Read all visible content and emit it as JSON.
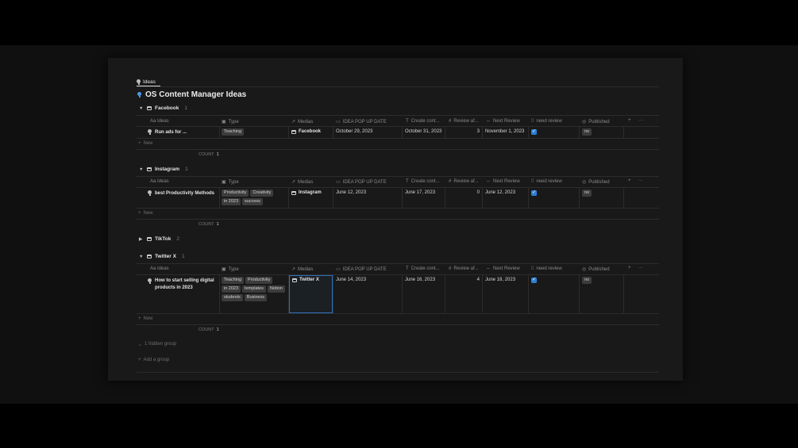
{
  "tab": {
    "label": "Ideas"
  },
  "page": {
    "title": "OS Content Manager Ideas"
  },
  "columns": [
    {
      "label": "Aa Ideas",
      "icon": ""
    },
    {
      "label": "Type",
      "icon": "tag-icon"
    },
    {
      "label": "Medias",
      "icon": "relation-arrow-icon"
    },
    {
      "label": "IDEA POP UP DATE",
      "icon": "calendar-icon"
    },
    {
      "label": "Create cont...",
      "icon": "formula-icon"
    },
    {
      "label": "Review af...",
      "icon": "hash-icon"
    },
    {
      "label": "Next Review",
      "icon": "rollup-icon"
    },
    {
      "label": "need review",
      "icon": "checkbox-icon"
    },
    {
      "label": "Published",
      "icon": "status-icon"
    }
  ],
  "groups": [
    {
      "name": "Facebook",
      "count": "1",
      "rows": [
        {
          "idea": "Run ads for ...",
          "types": [
            "Teaching"
          ],
          "media": "Facebook",
          "idea_date": "October 29, 2023",
          "create": "October 31, 2023",
          "review_after": "3",
          "next_review": "November 1, 2023",
          "need_review": true,
          "published": "no"
        }
      ],
      "new_label": "New",
      "count_label": "COUNT",
      "count_value": "1"
    },
    {
      "name": "Instagram",
      "count": "1",
      "rows": [
        {
          "idea": "best Productivity Methods",
          "types": [
            "Productivity",
            "Creativity",
            "in 2023",
            "success"
          ],
          "media": "Instagram",
          "idea_date": "June 12, 2023",
          "create": "June 17, 2023",
          "review_after": "0",
          "next_review": "June 12, 2023",
          "need_review": true,
          "published": "no"
        }
      ],
      "new_label": "New",
      "count_label": "COUNT",
      "count_value": "1"
    },
    {
      "name": "TikTok",
      "count": "2",
      "collapsed": true
    },
    {
      "name": "Twitter X",
      "count": "1",
      "rows": [
        {
          "idea": "How to start selling digital products in 2023",
          "types": [
            "Teaching",
            "Productivity",
            "in 2023",
            "templates",
            "Notion",
            "students",
            "Business"
          ],
          "media": "Twitter X",
          "idea_date": "June 14, 2023",
          "create": "June 16, 2023",
          "review_after": "4",
          "next_review": "June 18, 2023",
          "need_review": true,
          "published": "no"
        }
      ],
      "new_label": "New",
      "count_label": "COUNT",
      "count_value": "1"
    }
  ],
  "footer": {
    "hidden_group": "1 hidden group",
    "add_group": "Add a group"
  },
  "header_actions": {
    "add": "+",
    "more": "···"
  },
  "colors": {
    "background": "#191919",
    "accent": "#2f7fd6",
    "tag": "#3c3c3c"
  }
}
